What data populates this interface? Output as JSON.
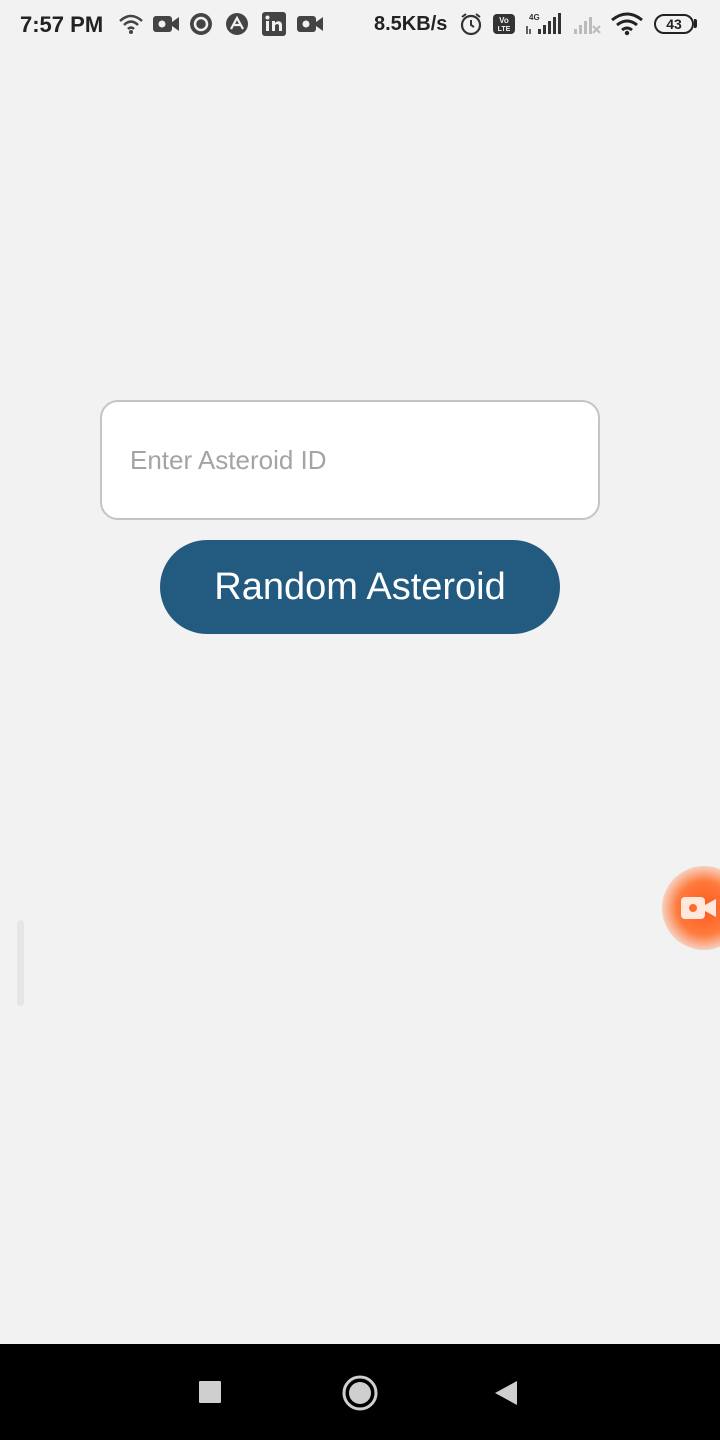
{
  "status_bar": {
    "time": "7:57 PM",
    "net_speed": "8.5KB/s",
    "battery": "43",
    "network_type": "4G",
    "icons": [
      "wifi-icon",
      "video-camera-icon",
      "circle-app-icon",
      "arrow-app-icon",
      "linkedin-icon",
      "video-camera-icon",
      "alarm-icon",
      "volte-icon",
      "signal-icon",
      "no-signal-icon",
      "wifi-icon",
      "battery-icon"
    ]
  },
  "main": {
    "asteroid_input": {
      "placeholder": "Enter Asteroid ID",
      "value": ""
    },
    "random_button_label": "Random Asteroid"
  },
  "colors": {
    "background": "#f2f2f2",
    "button": "#235a80",
    "bubble": "#ff5a1f"
  },
  "nav_bar": {
    "buttons": [
      "recents-button",
      "home-button",
      "back-button"
    ]
  }
}
